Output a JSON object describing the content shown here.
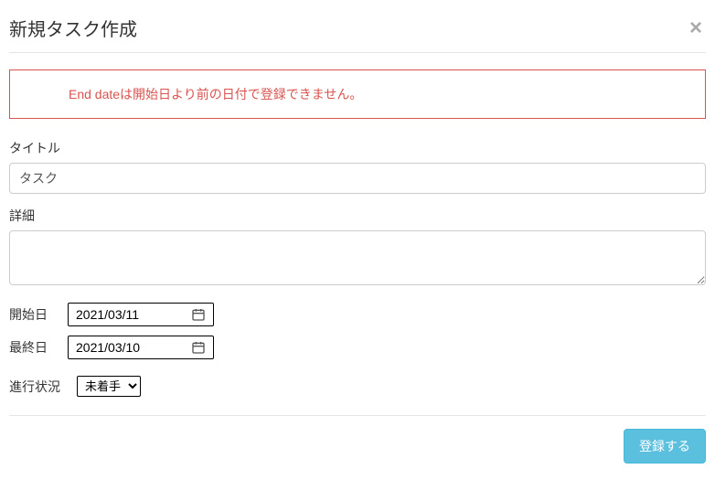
{
  "modal": {
    "title": "新規タスク作成",
    "close_label": "×"
  },
  "alert": {
    "error_message": "End dateは開始日より前の日付で登録できません。"
  },
  "form": {
    "title_label": "タイトル",
    "title_value": "タスク",
    "detail_label": "詳細",
    "detail_value": "",
    "start_date_label": "開始日",
    "start_date_value": "2021/03/11",
    "end_date_label": "最終日",
    "end_date_value": "2021/03/10",
    "status_label": "進行状況",
    "status_selected": "未着手"
  },
  "footer": {
    "submit_label": "登録する"
  }
}
